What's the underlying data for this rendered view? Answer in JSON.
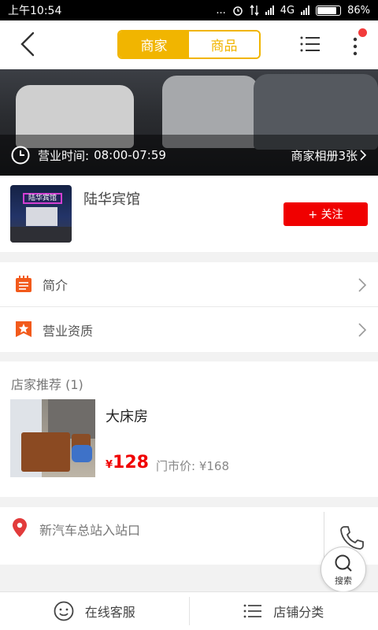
{
  "status_bar": {
    "time": "上午10:54",
    "dots": "...",
    "network": "4G",
    "battery_percent": "86%",
    "battery_level": 0.86
  },
  "header": {
    "tabs": [
      {
        "label": "商家",
        "active": true
      },
      {
        "label": "商品",
        "active": false
      }
    ]
  },
  "banner": {
    "hours_label": "营业时间:",
    "hours_value": "08:00-07:59",
    "album_text": "商家相册3张"
  },
  "shop": {
    "sign_text": "陆华宾馆",
    "name": "陆华宾馆",
    "follow_label": "+ 关注"
  },
  "info_items": [
    {
      "label": "简介",
      "icon": "notepad-icon"
    },
    {
      "label": "营业资质",
      "icon": "star-badge-icon"
    }
  ],
  "recommend": {
    "title": "店家推荐 (1)",
    "item": {
      "name": "大床房",
      "currency": "¥",
      "price": "128",
      "market_price": "门市价: ¥168"
    }
  },
  "address": {
    "text": "新汽车总站入站口"
  },
  "search_fab": {
    "label": "搜索"
  },
  "bottom_bar": {
    "left_label": "在线客服",
    "right_label": "店铺分类"
  },
  "colors": {
    "accent_yellow": "#f1b500",
    "follow_red": "#f00000",
    "icon_orange": "#f25a1b"
  }
}
